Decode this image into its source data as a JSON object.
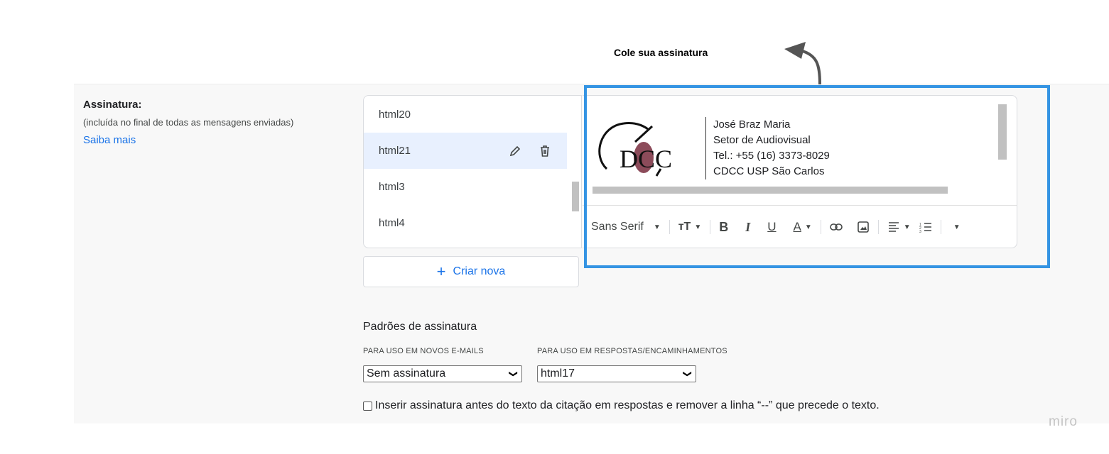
{
  "annotation": {
    "text": "Cole sua assinatura"
  },
  "signature_section": {
    "title": "Assinatura:",
    "subtitle": "(incluída no final de todas as mensagens enviadas)",
    "link": "Saiba mais"
  },
  "signature_list": {
    "items": [
      {
        "label": "html20",
        "selected": false
      },
      {
        "label": "html21",
        "selected": true
      },
      {
        "label": "html3",
        "selected": false
      },
      {
        "label": "html4",
        "selected": false
      }
    ],
    "create_button": "Criar nova"
  },
  "editor": {
    "signature_lines": [
      "José Braz Maria",
      "Setor de Audiovisual",
      "Tel.: +55 (16) 3373-8029",
      "CDCC USP São Carlos"
    ],
    "logo_text": "DCC",
    "toolbar": {
      "font": "Sans Serif",
      "bold": "B",
      "italic": "I",
      "underline": "U",
      "text_color": "A"
    }
  },
  "defaults": {
    "title": "Padrões de assinatura",
    "new_emails_label": "PARA USO EM NOVOS E-MAILS",
    "new_emails_value": "Sem assinatura",
    "replies_label": "PARA USO EM RESPOSTAS/ENCAMINHAMENTOS",
    "replies_value": "html17",
    "checkbox_label": "Inserir assinatura antes do texto da citação em respostas e remover a linha “--” que precede o texto."
  },
  "watermark": "miro",
  "colors": {
    "highlight_box": "#3594e3",
    "link": "#1a73e8",
    "selected_row": "#e8f0fe"
  }
}
